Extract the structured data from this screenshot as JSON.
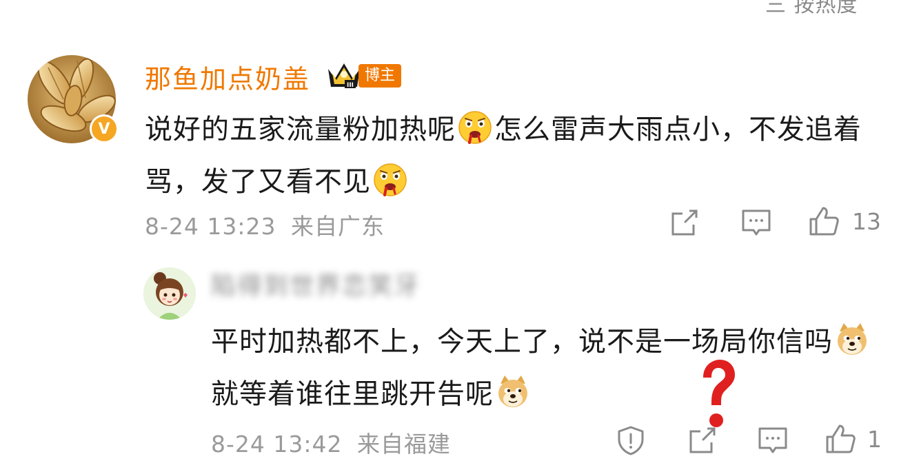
{
  "header": {
    "sort_label": "三 按热度"
  },
  "main_comment": {
    "username": "那鱼加点奶盖",
    "author_badge": "博主",
    "verified_mark": "V",
    "text_part1": "说好的五家流量粉加热呢",
    "text_part2": "怎么雷声大雨点小，不发追着骂，发了又看不见",
    "emoji": "crying-face-emoji",
    "date": "8-24 13:23",
    "location": "来自广东",
    "like_count": "13",
    "icons": [
      "share-icon",
      "comment-icon",
      "like-icon"
    ]
  },
  "reply": {
    "username": "陷得到世界恋笑牙",
    "text_part1": "平时加热都不上，今天上了，说不是一场局你信吗",
    "text_part2": "就等着谁往里跳开告呢",
    "emoji": "doge-emoji",
    "date": "8-24 13:42",
    "location": "来自福建",
    "like_count": "1",
    "icons": [
      "report-icon",
      "share-icon",
      "comment-icon",
      "like-icon"
    ]
  },
  "colors": {
    "username_orange": "#f07800",
    "meta_gray": "#9a9a9a",
    "question_red": "#e02020"
  }
}
